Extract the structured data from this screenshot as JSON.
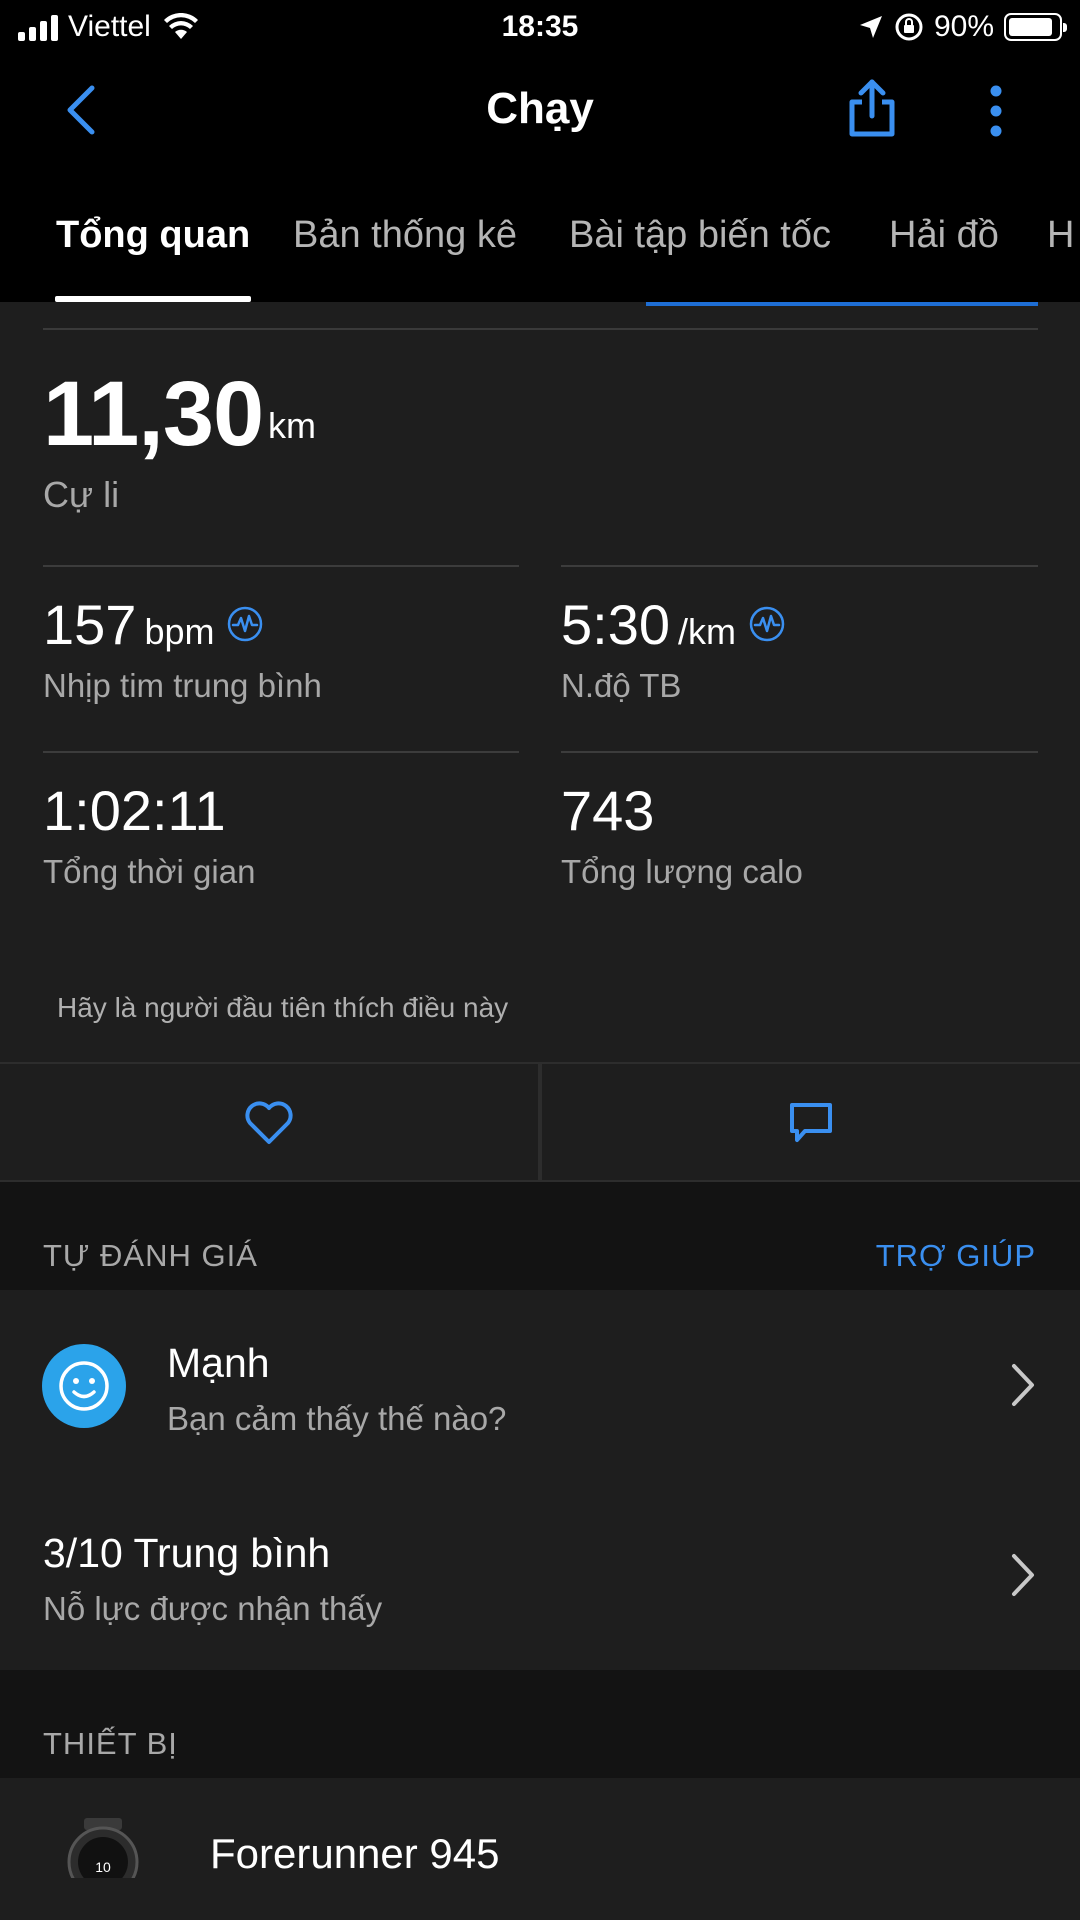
{
  "status_bar": {
    "carrier": "Viettel",
    "time": "18:35",
    "battery": "90%",
    "battery_level": 0.9
  },
  "nav": {
    "title": "Chạy",
    "back_icon": "chevron-left-icon",
    "share_icon": "share-icon",
    "more_icon": "more-vertical-icon",
    "accent_color": "#3a8ff0"
  },
  "tabs": [
    {
      "label": "Tổng quan",
      "active": true
    },
    {
      "label": "Bản thống kê",
      "active": false
    },
    {
      "label": "Bài tập biến tốc",
      "active": false
    },
    {
      "label": "Hải đồ",
      "active": false
    },
    {
      "label": "H",
      "active": false
    }
  ],
  "summary": {
    "distance_value": "11,30",
    "distance_unit": "km",
    "distance_label": "Cự li",
    "stats": [
      {
        "value": "157",
        "unit": "bpm",
        "label": "Nhịp tim trung bình",
        "icon": "heart-rate-sensor-icon"
      },
      {
        "value": "5:30",
        "unit": "/km",
        "label": "N.độ TB",
        "icon": "heart-rate-sensor-icon"
      },
      {
        "value": "1:02:11",
        "unit": "",
        "label": "Tổng thời gian"
      },
      {
        "value": "743",
        "unit": "",
        "label": "Tổng lượng calo"
      }
    ]
  },
  "social": {
    "like_prompt": "Hãy là người đầu tiên thích điều này",
    "like_icon": "heart-icon",
    "comment_icon": "comment-icon"
  },
  "self_evaluation": {
    "header": "TỰ ĐÁNH GIÁ",
    "help_link": "TRỢ GIÚP",
    "feeling_title": "Mạnh",
    "feeling_sub": "Bạn cảm thấy thế nào?",
    "effort_title": "3/10 Trung bình",
    "effort_sub": "Nỗ lực được nhận thấy"
  },
  "device": {
    "header": "THIẾT BỊ",
    "name": "Forerunner 945"
  }
}
